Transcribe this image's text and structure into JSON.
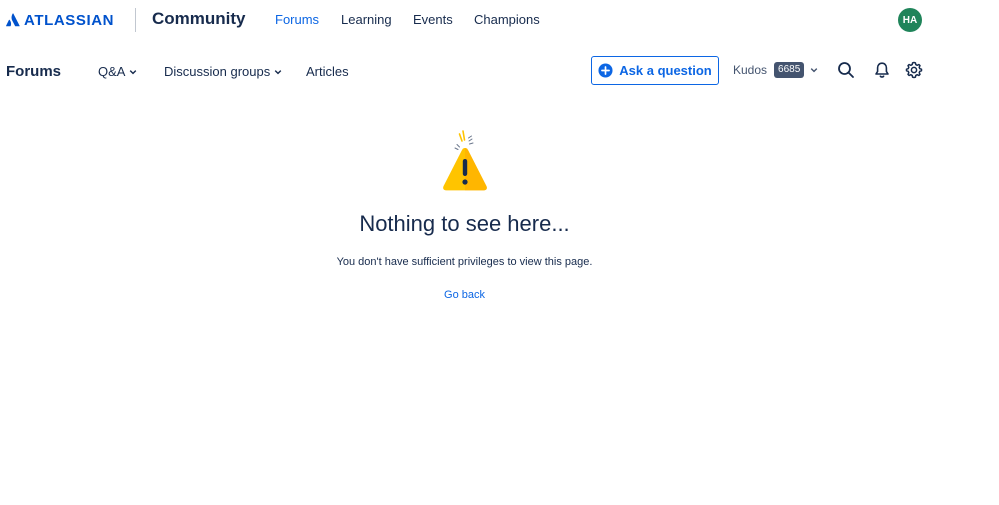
{
  "topbar": {
    "brand": "ATLASSIAN",
    "community": "Community",
    "nav": [
      {
        "label": "Forums"
      },
      {
        "label": "Learning"
      },
      {
        "label": "Events"
      },
      {
        "label": "Champions"
      }
    ],
    "avatar_initials": "HA"
  },
  "subbar": {
    "title": "Forums",
    "nav": [
      {
        "label": "Q&A"
      },
      {
        "label": "Discussion groups"
      },
      {
        "label": "Articles"
      }
    ],
    "ask_label": "Ask a question",
    "kudos_label": "Kudos",
    "kudos_count": "6685",
    "icons": [
      "search-icon",
      "bell-icon",
      "gear-icon"
    ]
  },
  "main": {
    "headline": "Nothing to see here...",
    "message": "You don't have sufficient privileges to view this page.",
    "go_back": "Go back"
  },
  "colors": {
    "brand_blue": "#0052cc",
    "link_blue": "#0c66e4",
    "text": "#172b4d",
    "avatar_green": "#1f845a",
    "warning_yellow": "#ffc400"
  }
}
